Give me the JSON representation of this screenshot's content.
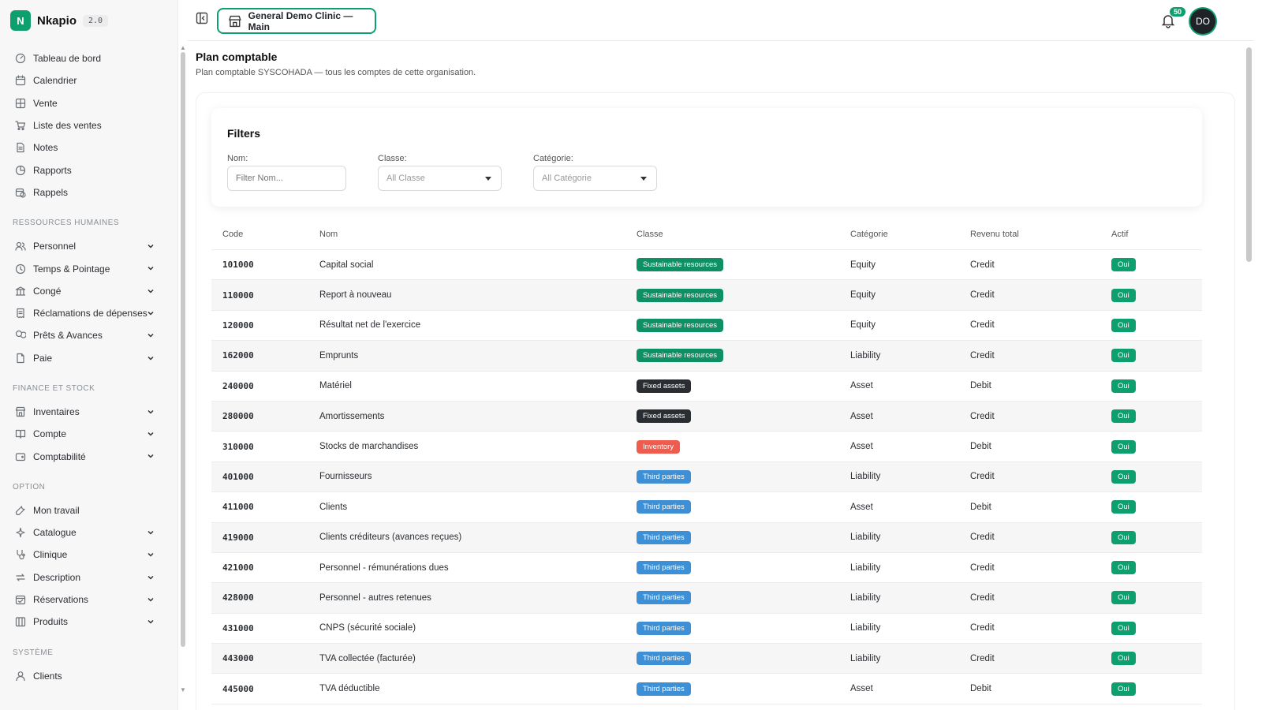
{
  "brand": {
    "logo_letter": "N",
    "name": "Nkapio",
    "version": "2.0"
  },
  "sidebar": {
    "main_items": [
      {
        "label": "Tableau de bord",
        "icon": "gauge-icon"
      },
      {
        "label": "Calendrier",
        "icon": "calendar-icon"
      },
      {
        "label": "Vente",
        "icon": "grid-icon"
      },
      {
        "label": "Liste des ventes",
        "icon": "cart-icon"
      },
      {
        "label": "Notes",
        "icon": "document-icon"
      },
      {
        "label": "Rapports",
        "icon": "pie-chart-icon"
      },
      {
        "label": "Rappels",
        "icon": "calendar-clock-icon"
      }
    ],
    "sections": [
      {
        "title": "RESSOURCES HUMAINES",
        "items": [
          {
            "label": "Personnel",
            "icon": "users-icon"
          },
          {
            "label": "Temps & Pointage",
            "icon": "clock-icon"
          },
          {
            "label": "Congé",
            "icon": "bank-icon"
          },
          {
            "label": "Réclamations de dépenses",
            "icon": "receipt-icon"
          },
          {
            "label": "Prêts & Avances",
            "icon": "coins-icon"
          },
          {
            "label": "Paie",
            "icon": "file-icon"
          }
        ]
      },
      {
        "title": "FINANCE ET STOCK",
        "items": [
          {
            "label": "Inventaires",
            "icon": "store-icon"
          },
          {
            "label": "Compte",
            "icon": "book-icon"
          },
          {
            "label": "Comptabilité",
            "icon": "wallet-icon"
          }
        ]
      },
      {
        "title": "OPTION",
        "items": [
          {
            "label": "Mon travail",
            "icon": "wrench-icon"
          },
          {
            "label": "Catalogue",
            "icon": "sparkle-icon"
          },
          {
            "label": "Clinique",
            "icon": "stethoscope-icon"
          },
          {
            "label": "Description",
            "icon": "repeat-icon"
          },
          {
            "label": "Réservations",
            "icon": "calendar-check-icon"
          },
          {
            "label": "Produits",
            "icon": "box-icon"
          }
        ]
      },
      {
        "title": "SYSTÈME",
        "items": [
          {
            "label": "Clients",
            "icon": "user-icon"
          }
        ]
      }
    ]
  },
  "header": {
    "clinic_label": "General Demo Clinic — Main",
    "notification_count": "50",
    "avatar_initials": "DO"
  },
  "page": {
    "title": "Plan comptable",
    "subtitle": "Plan comptable SYSCOHADA — tous les comptes de cette organisation."
  },
  "filters": {
    "title": "Filters",
    "nom_label": "Nom:",
    "nom_placeholder": "Filter Nom...",
    "classe_label": "Classe:",
    "classe_value": "All Classe",
    "categorie_label": "Catégorie:",
    "categorie_value": "All Catégorie"
  },
  "table": {
    "headers": {
      "code": "Code",
      "nom": "Nom",
      "classe": "Classe",
      "categorie": "Catégorie",
      "revenu": "Revenu total",
      "actif": "Actif"
    },
    "rows": [
      {
        "code": "101000",
        "nom": "Capital social",
        "classe": "Sustainable resources",
        "classe_type": "sus",
        "categorie": "Equity",
        "revenu": "Credit",
        "actif": "Oui"
      },
      {
        "code": "110000",
        "nom": "Report à nouveau",
        "classe": "Sustainable resources",
        "classe_type": "sus",
        "categorie": "Equity",
        "revenu": "Credit",
        "actif": "Oui"
      },
      {
        "code": "120000",
        "nom": "Résultat net de l'exercice",
        "classe": "Sustainable resources",
        "classe_type": "sus",
        "categorie": "Equity",
        "revenu": "Credit",
        "actif": "Oui"
      },
      {
        "code": "162000",
        "nom": "Emprunts",
        "classe": "Sustainable resources",
        "classe_type": "sus",
        "categorie": "Liability",
        "revenu": "Credit",
        "actif": "Oui"
      },
      {
        "code": "240000",
        "nom": "Matériel",
        "classe": "Fixed assets",
        "classe_type": "fix",
        "categorie": "Asset",
        "revenu": "Debit",
        "actif": "Oui"
      },
      {
        "code": "280000",
        "nom": "Amortissements",
        "classe": "Fixed assets",
        "classe_type": "fix",
        "categorie": "Asset",
        "revenu": "Credit",
        "actif": "Oui"
      },
      {
        "code": "310000",
        "nom": "Stocks de marchandises",
        "classe": "Inventory",
        "classe_type": "inv",
        "categorie": "Asset",
        "revenu": "Debit",
        "actif": "Oui"
      },
      {
        "code": "401000",
        "nom": "Fournisseurs",
        "classe": "Third parties",
        "classe_type": "third",
        "categorie": "Liability",
        "revenu": "Credit",
        "actif": "Oui"
      },
      {
        "code": "411000",
        "nom": "Clients",
        "classe": "Third parties",
        "classe_type": "third",
        "categorie": "Asset",
        "revenu": "Debit",
        "actif": "Oui"
      },
      {
        "code": "419000",
        "nom": "Clients créditeurs (avances reçues)",
        "classe": "Third parties",
        "classe_type": "third",
        "categorie": "Liability",
        "revenu": "Credit",
        "actif": "Oui"
      },
      {
        "code": "421000",
        "nom": "Personnel - rémunérations dues",
        "classe": "Third parties",
        "classe_type": "third",
        "categorie": "Liability",
        "revenu": "Credit",
        "actif": "Oui"
      },
      {
        "code": "428000",
        "nom": "Personnel - autres retenues",
        "classe": "Third parties",
        "classe_type": "third",
        "categorie": "Liability",
        "revenu": "Credit",
        "actif": "Oui"
      },
      {
        "code": "431000",
        "nom": "CNPS (sécurité sociale)",
        "classe": "Third parties",
        "classe_type": "third",
        "categorie": "Liability",
        "revenu": "Credit",
        "actif": "Oui"
      },
      {
        "code": "443000",
        "nom": "TVA collectée (facturée)",
        "classe": "Third parties",
        "classe_type": "third",
        "categorie": "Liability",
        "revenu": "Credit",
        "actif": "Oui"
      },
      {
        "code": "445000",
        "nom": "TVA déductible",
        "classe": "Third parties",
        "classe_type": "third",
        "categorie": "Asset",
        "revenu": "Debit",
        "actif": "Oui"
      }
    ]
  },
  "colors": {
    "accent": "#0e9f6e",
    "fixed": "#2a2d31",
    "inventory": "#ef5b4c",
    "third": "#3d8fd6"
  }
}
